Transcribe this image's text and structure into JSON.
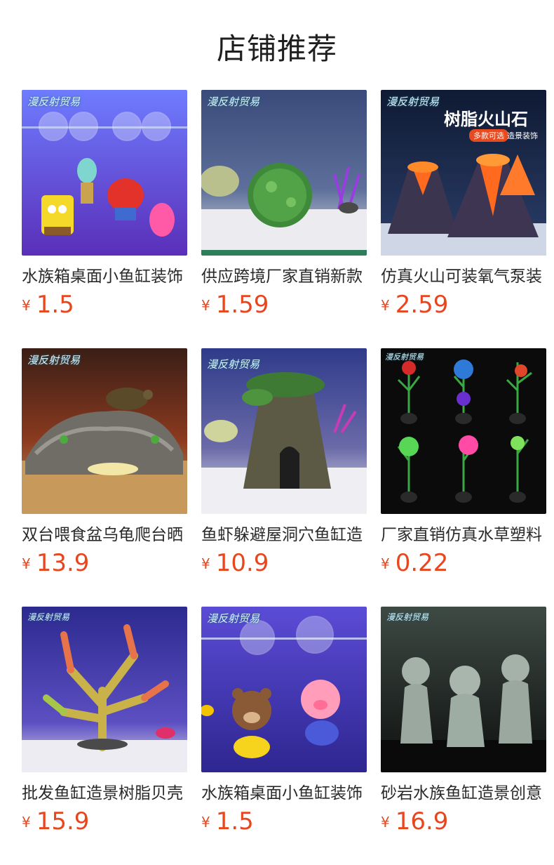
{
  "section_title": "店铺推荐",
  "currency": "¥",
  "watermark": "漫反射贸易",
  "banner": {
    "headline": "树脂火山石",
    "tag_left": "多款可选",
    "tag_right": "造景装饰"
  },
  "products": [
    {
      "name": "水族箱桌面小鱼缸装饰",
      "price": "1.5",
      "image": "cartoon-float-ornaments"
    },
    {
      "name": "供应跨境厂家直销新款",
      "price": "1.59",
      "image": "moss-ball"
    },
    {
      "name": "仿真火山可装氧气泵装",
      "price": "2.59",
      "image": "resin-volcano"
    },
    {
      "name": "双台喂食盆乌龟爬台晒",
      "price": "13.9",
      "image": "turtle-basking-platform"
    },
    {
      "name": "鱼虾躲避屋洞穴鱼缸造",
      "price": "10.9",
      "image": "tree-stump-cave"
    },
    {
      "name": "厂家直销仿真水草塑料",
      "price": "0.22",
      "image": "artificial-plants"
    },
    {
      "name": "批发鱼缸造景树脂贝壳",
      "price": "15.9",
      "image": "coral-ornament"
    },
    {
      "name": "水族箱桌面小鱼缸装饰",
      "price": "1.5",
      "image": "bear-pig-float-ornaments"
    },
    {
      "name": "砂岩水族鱼缸造景创意",
      "price": "16.9",
      "image": "sandstone-monks"
    }
  ]
}
